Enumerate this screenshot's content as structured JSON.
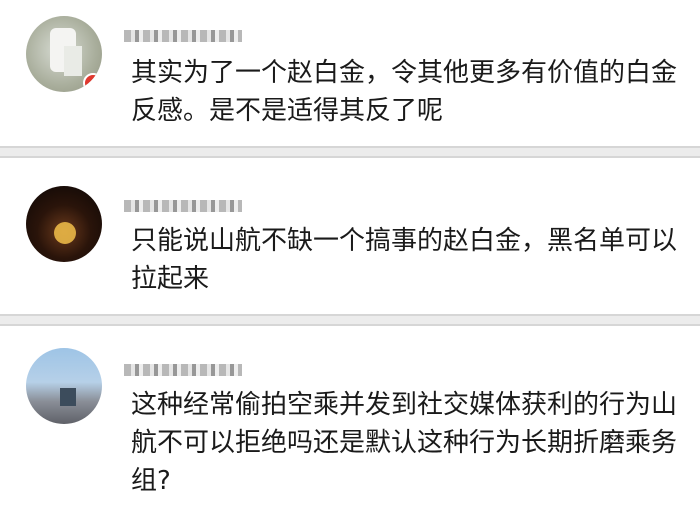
{
  "comments": [
    {
      "user_name": "",
      "text": "其实为了一个赵白金，令其他更多有价值的白金反感。是不是适得其反了呢",
      "badge_icon": "verified-badge-icon"
    },
    {
      "user_name": "",
      "text": "只能说山航不缺一个搞事的赵白金，黑名单可以拉起来"
    },
    {
      "user_name": "",
      "text": "这种经常偷拍空乘并发到社交媒体获利的行为山航不可以拒绝吗还是默认这种行为长期折磨乘务组?"
    }
  ]
}
